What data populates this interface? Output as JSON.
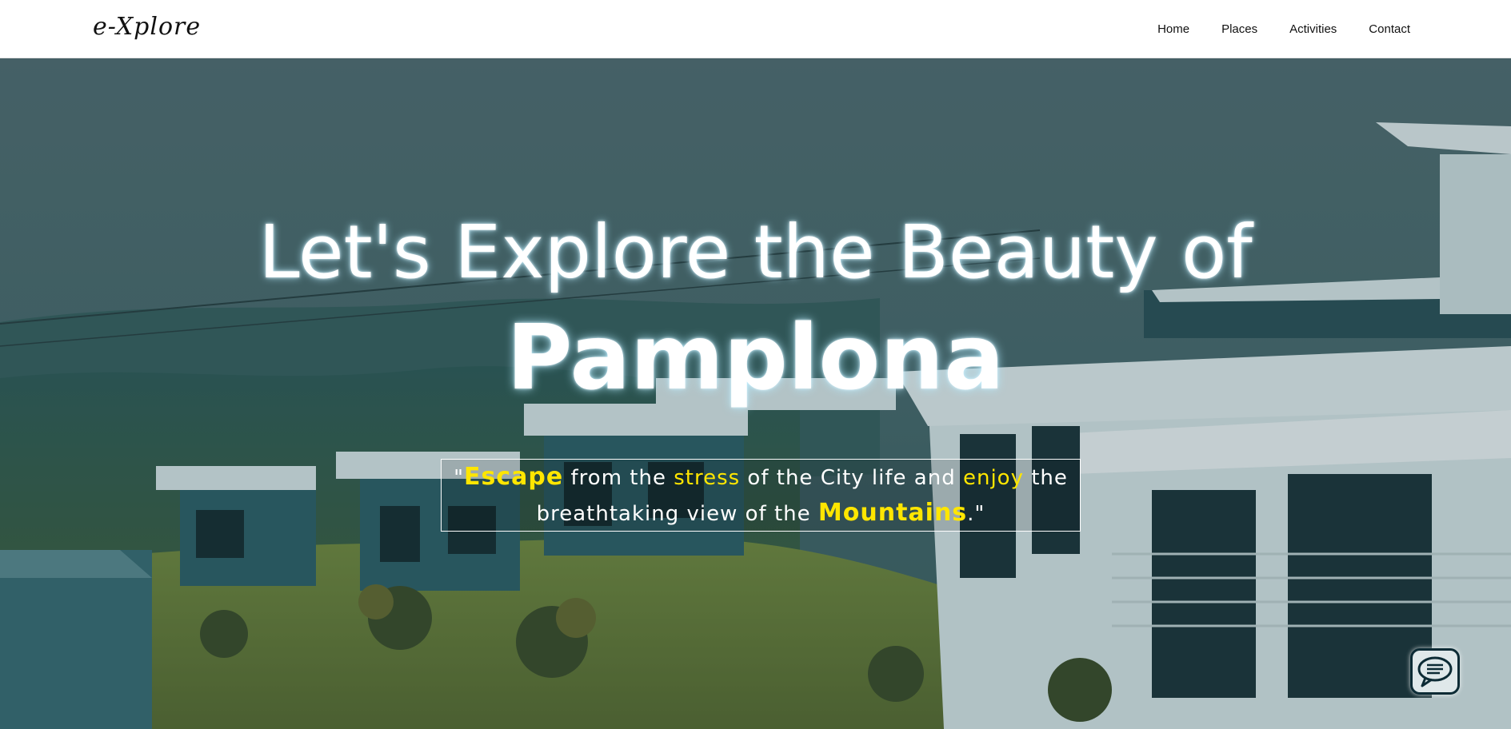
{
  "header": {
    "logo_text": "e-Xplore",
    "nav": [
      {
        "label": "Home"
      },
      {
        "label": "Places"
      },
      {
        "label": "Activities"
      },
      {
        "label": "Contact"
      }
    ]
  },
  "hero": {
    "headline": "Let's Explore the Beauty of",
    "city": "Pamplona",
    "quote": {
      "open_quote": "\"",
      "word_escape": "Escape",
      "text_1": " from the ",
      "word_stress": "stress",
      "text_2": " of the City life and ",
      "word_enjoy": "enjoy",
      "text_3": " the",
      "text_4": "breathtaking view of the ",
      "word_mountains": "Mountains",
      "close_quote": ".\""
    },
    "highlight_color": "#ffe600"
  },
  "chat": {
    "icon": "chat-bubble-icon"
  }
}
